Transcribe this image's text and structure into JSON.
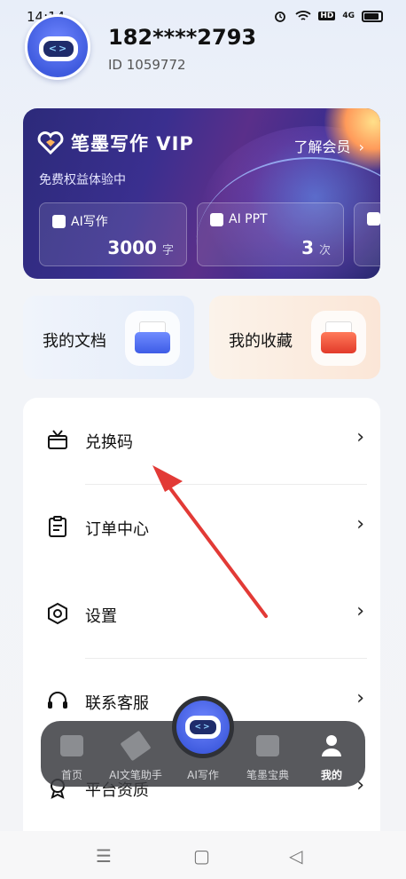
{
  "status_bar": {
    "time": "14:14",
    "icons": [
      "alarm-icon",
      "wifi-icon",
      "hd-icon",
      "4g-signal-icon",
      "battery-icon"
    ],
    "hd_text": "HD",
    "network_text": "4G"
  },
  "profile": {
    "phone": "182****2793",
    "id_text": "ID 1059772"
  },
  "vip": {
    "title": "笔墨写作 VIP",
    "learn_more": "了解会员",
    "subtitle": "免费权益体验中",
    "tiles": [
      {
        "label": "AI写作",
        "value": "3000",
        "unit": "字"
      },
      {
        "label": "AI PPT",
        "value": "3",
        "unit": "次"
      }
    ]
  },
  "shortcuts": {
    "docs": "我的文档",
    "favorites": "我的收藏"
  },
  "menu": {
    "items": [
      {
        "label": "兑换码",
        "icon": "gift-box-icon"
      },
      {
        "label": "订单中心",
        "icon": "clipboard-icon"
      },
      {
        "label": "设置",
        "icon": "settings-hexagon-icon"
      },
      {
        "label": "联系客服",
        "icon": "headset-icon"
      },
      {
        "label": "平台资质",
        "icon": "badge-icon"
      }
    ],
    "chevron": "›"
  },
  "tabbar": {
    "tabs": [
      {
        "label": "首页",
        "icon": "home-icon"
      },
      {
        "label": "AI文笔助手",
        "icon": "pen-icon"
      },
      {
        "label": "AI写作",
        "icon": "robot-icon"
      },
      {
        "label": "笔墨宝典",
        "icon": "folder-icon"
      },
      {
        "label": "我的",
        "icon": "person-icon"
      }
    ],
    "active": "我的"
  },
  "colors": {
    "vip_bg": "#2c2a7a",
    "annotation_arrow": "#e23a36",
    "tabbar_bg": "#3c3e42"
  }
}
